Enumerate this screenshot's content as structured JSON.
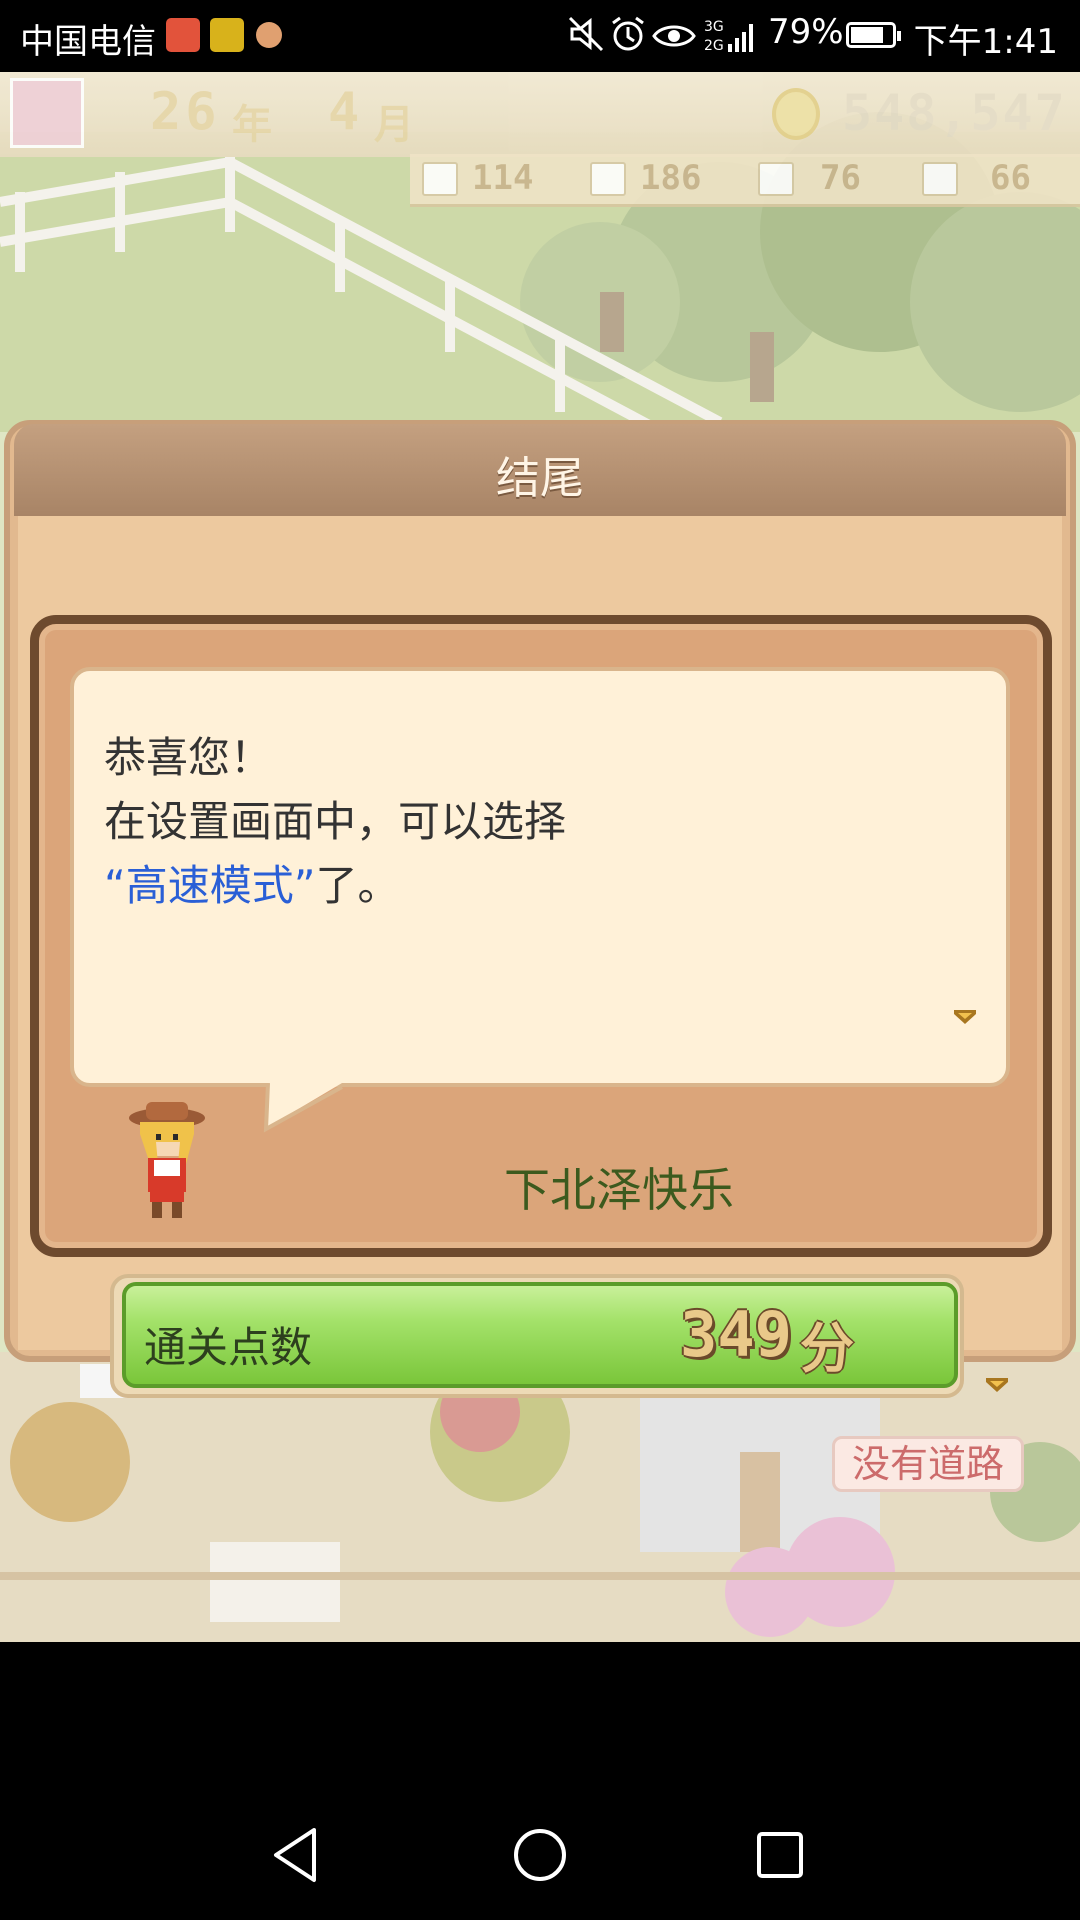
{
  "status_bar": {
    "carrier": "中国电信",
    "battery_percent": "79%",
    "battery_level": 0.79,
    "network": "3G 2G",
    "time": "下午1:41",
    "icons": [
      "mute-icon",
      "alarm-icon",
      "eye-icon",
      "signal-icon",
      "battery-icon"
    ]
  },
  "hud": {
    "year": "26",
    "year_unit": "年",
    "month": "4",
    "month_unit": "月",
    "money": "548,547",
    "resources": [
      {
        "icon": "flower-icon",
        "value": "114"
      },
      {
        "icon": "carrot-icon",
        "value": "186"
      },
      {
        "icon": "tomato-icon",
        "value": "76"
      },
      {
        "icon": "animal-icon",
        "value": "66"
      }
    ]
  },
  "dialog": {
    "title": "结尾",
    "message_line1": "恭喜您！",
    "message_line2": "在设置画面中，可以选择",
    "message_highlight": "“高速模式”",
    "message_line3_suffix": "了。",
    "speaker": "下北泽快乐",
    "score_label": "通关点数",
    "score_value": "349",
    "score_unit": "分"
  },
  "map": {
    "road_tag": "没有道路"
  },
  "colors": {
    "highlight": "#2a5fd6",
    "score_green": "#7ac63a",
    "dialog_border": "#6e4a2e"
  }
}
